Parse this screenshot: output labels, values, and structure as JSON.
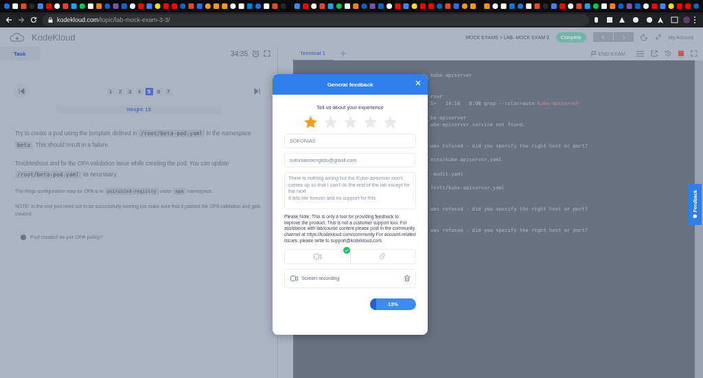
{
  "address_bar": {
    "domain": "kodekloud.com",
    "path": "/topic/lab-mock-exam-3-3/"
  },
  "header": {
    "logo": "KodeKloud",
    "breadcrumb": "MOCK EXAMS > LAB- MOCK EXAM 3",
    "complete_button": "Complete",
    "account": "My Account"
  },
  "task_panel": {
    "tab": "Task",
    "timer": "34:35",
    "pages": [
      {
        "label": "1",
        "selected": false
      },
      {
        "label": "2",
        "selected": false
      },
      {
        "label": "3",
        "selected": false
      },
      {
        "label": "4",
        "selected": false
      },
      {
        "label": "5",
        "selected": true
      },
      {
        "label": "6",
        "selected": false
      },
      {
        "label": "7",
        "selected": false
      }
    ],
    "weight": "Weight: 15",
    "paragraphs": [
      {
        "kind": "main",
        "segments": [
          {
            "kind": "text",
            "text": "Try to create a pod using the template defined in "
          },
          {
            "kind": "code",
            "text": "/root/beta-pod.yaml"
          },
          {
            "kind": "text",
            "text": " in the namespace "
          },
          {
            "kind": "code",
            "text": "beta"
          },
          {
            "kind": "text",
            "text": ". This should result in a failure."
          }
        ]
      },
      {
        "kind": "main",
        "segments": [
          {
            "kind": "text",
            "text": "Troubleshoot and fix the OPA validation issue while creating the pod. You can update "
          },
          {
            "kind": "code",
            "text": "/root/beta-pod.yaml"
          },
          {
            "kind": "text",
            "text": " as necessary."
          }
        ]
      },
      {
        "kind": "small",
        "segments": [
          {
            "kind": "text",
            "text": "The Rego configuration map for OPA is in "
          },
          {
            "kind": "code",
            "text": "untrusted-registry"
          },
          {
            "kind": "text",
            "text": " under "
          },
          {
            "kind": "code",
            "text": "opa"
          },
          {
            "kind": "text",
            "text": " namespace."
          }
        ]
      },
      {
        "kind": "small",
        "segments": [
          {
            "kind": "text",
            "text": "NOTE: In the end pod need not to be successfully running but make sure that it passed the OPA validation and gets created."
          }
        ]
      }
    ],
    "checks": [
      {
        "label": "Pod created as per OPA policy?",
        "done": false
      }
    ]
  },
  "terminal": {
    "tab": "Terminal 1",
    "end_exam": "END EXAM",
    "lines": [
      {
        "kind": "text",
        "segments": [
          {
            "kind": "plain",
            "text": "kube-apiserver"
          }
        ]
      },
      {
        "kind": "text",
        "segments": [
          {
            "kind": "plain",
            "text": "-"
          }
        ]
      },
      {
        "kind": "blank"
      },
      {
        "kind": "text",
        "segments": [
          {
            "kind": "plain",
            "text": "rver"
          }
        ]
      },
      {
        "kind": "text",
        "segments": [
          {
            "kind": "plain",
            "text": "S+   14:16   0:00 grep --color=auto "
          },
          {
            "kind": "match",
            "text": "kube-apiserver"
          }
        ]
      },
      {
        "kind": "blank"
      },
      {
        "kind": "text",
        "segments": [
          {
            "kind": "plain",
            "text": "be-apiserver"
          }
        ]
      },
      {
        "kind": "text",
        "segments": [
          {
            "kind": "plain",
            "text": "ube-apiserver.service not found."
          }
        ]
      },
      {
        "kind": "blank"
      },
      {
        "kind": "blank"
      },
      {
        "kind": "text",
        "segments": [
          {
            "kind": "plain",
            "text": "was refused - did you specify the right host or port?"
          }
        ]
      },
      {
        "kind": "blank"
      },
      {
        "kind": "text",
        "segments": [
          {
            "kind": "plain",
            "text": "ests/kube-apiserver.yaml"
          }
        ]
      },
      {
        "kind": "blank"
      },
      {
        "kind": "text",
        "segments": [
          {
            "kind": "plain",
            "text": "-audit.yaml"
          }
        ]
      },
      {
        "kind": "blank"
      },
      {
        "kind": "text",
        "segments": [
          {
            "kind": "plain",
            "text": "fests/kube-apiserver.yaml"
          }
        ]
      },
      {
        "kind": "blank"
      },
      {
        "kind": "blank"
      },
      {
        "kind": "text",
        "segments": [
          {
            "kind": "plain",
            "text": "was refused - did you specify the right host or port?"
          }
        ]
      },
      {
        "kind": "blank"
      },
      {
        "kind": "blank"
      },
      {
        "kind": "text",
        "segments": [
          {
            "kind": "plain",
            "text": "was refused - did you specify the right host or port?"
          }
        ]
      }
    ]
  },
  "feedback_tab": "Feedback",
  "modal": {
    "title": "General feedback",
    "prompt": "Tell us about your experience",
    "stars": 1,
    "name": "SOFONIAS",
    "email": "sofoniasmengistu@gmail.com",
    "message": "There is nothing wrong but the Kube-apiserver won't comes up so that I can't do the rest of the lab except for the next\nIt lets me forever and no support for this",
    "note": "Please Note: This is only a tool for providing feedback to improve the product. This is not a customer support tool. For assistance with lab/course content please post in the community channel at https://kodekloud.com/community For account-related issues, please write to support@kodekloud.com.",
    "video_attached": true,
    "recording": "Screen recording",
    "submit": {
      "label": "13%",
      "level": 0.13
    }
  }
}
